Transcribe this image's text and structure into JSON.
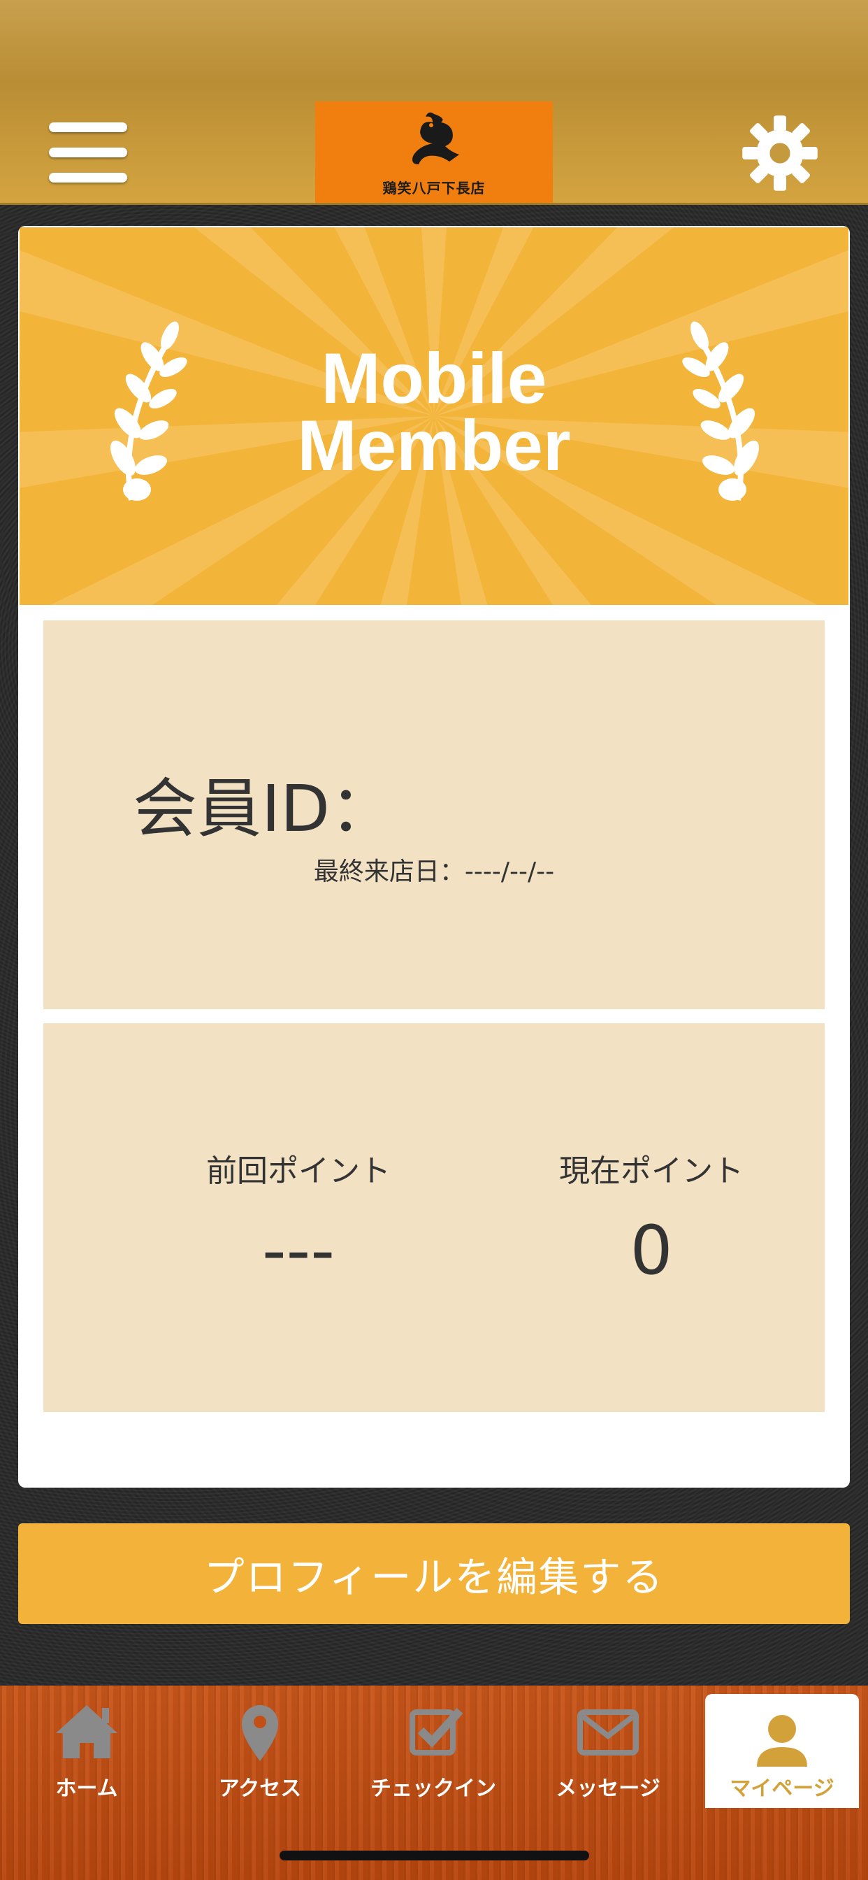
{
  "header": {
    "menu_icon": "hamburger-menu-icon",
    "logo_text": "鶏笑八戸下長店",
    "settings_icon": "gear-icon"
  },
  "banner": {
    "title_line1": "Mobile",
    "title_line2": "Member"
  },
  "member": {
    "id_label": "会員ID：",
    "last_visit": "最終来店日：----/--/--"
  },
  "points": {
    "previous_label": "前回ポイント",
    "previous_value": "---",
    "current_label": "現在ポイント",
    "current_value": "0"
  },
  "actions": {
    "edit_profile": "プロフィールを編集する"
  },
  "tabbar": {
    "items": [
      {
        "label": "ホーム",
        "icon": "home-icon"
      },
      {
        "label": "アクセス",
        "icon": "map-pin-icon"
      },
      {
        "label": "チェックイン",
        "icon": "checkbox-icon"
      },
      {
        "label": "メッセージ",
        "icon": "mail-icon"
      },
      {
        "label": "マイページ",
        "icon": "user-icon",
        "active": true
      }
    ]
  },
  "colors": {
    "accent": "#f3b33a",
    "panel": "#f2e1c2",
    "logo_bg": "#f07f0f",
    "tabbar": "#c24f16",
    "active_label": "#d3a13a"
  }
}
